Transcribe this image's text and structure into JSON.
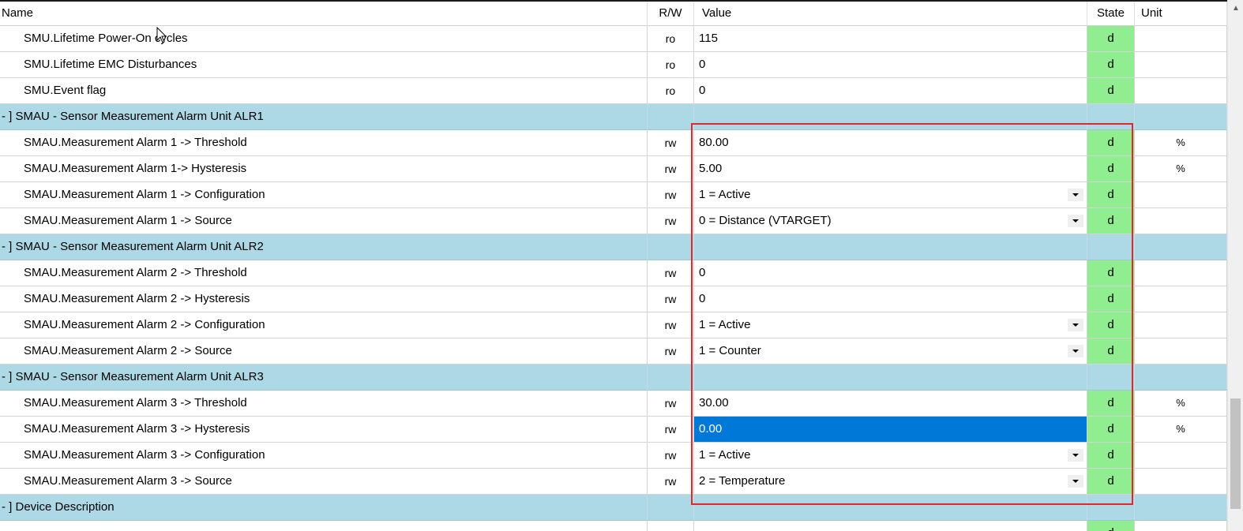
{
  "headers": {
    "name": "Name",
    "rw": "R/W",
    "value": "Value",
    "state": "State",
    "unit": "Unit"
  },
  "rows": [
    {
      "type": "item",
      "name": "SMU.Lifetime Power-On cycles",
      "rw": "ro",
      "value": "115",
      "state": "d",
      "unit": ""
    },
    {
      "type": "item",
      "name": "SMU.Lifetime EMC Disturbances",
      "rw": "ro",
      "value": "0",
      "state": "d",
      "unit": ""
    },
    {
      "type": "item",
      "name": "SMU.Event flag",
      "rw": "ro",
      "value": "0",
      "state": "d",
      "unit": ""
    },
    {
      "type": "group",
      "name": "- ]  SMAU - Sensor Measurement Alarm Unit ALR1"
    },
    {
      "type": "item",
      "name": "SMAU.Measurement Alarm 1 -> Threshold",
      "rw": "rw",
      "value": "80.00",
      "state": "d",
      "unit": "%"
    },
    {
      "type": "item",
      "name": "SMAU.Measurement Alarm 1->  Hysteresis",
      "rw": "rw",
      "value": "5.00",
      "state": "d",
      "unit": "%"
    },
    {
      "type": "item",
      "name": "SMAU.Measurement Alarm 1 -> Configuration",
      "rw": "rw",
      "value": "1 = Active",
      "dropdown": true,
      "state": "d",
      "unit": ""
    },
    {
      "type": "item",
      "name": "SMAU.Measurement Alarm 1 -> Source",
      "rw": "rw",
      "value": "0 = Distance (VTARGET)",
      "dropdown": true,
      "state": "d",
      "unit": ""
    },
    {
      "type": "group",
      "name": "- ]  SMAU - Sensor Measurement Alarm Unit ALR2"
    },
    {
      "type": "item",
      "name": "SMAU.Measurement Alarm 2 -> Threshold",
      "rw": "rw",
      "value": "0",
      "state": "d",
      "unit": ""
    },
    {
      "type": "item",
      "name": "SMAU.Measurement Alarm 2 -> Hysteresis",
      "rw": "rw",
      "value": "0",
      "state": "d",
      "unit": ""
    },
    {
      "type": "item",
      "name": "SMAU.Measurement Alarm 2 -> Configuration",
      "rw": "rw",
      "value": "1 = Active",
      "dropdown": true,
      "state": "d",
      "unit": ""
    },
    {
      "type": "item",
      "name": "SMAU.Measurement Alarm 2 -> Source",
      "rw": "rw",
      "value": "1 = Counter",
      "dropdown": true,
      "state": "d",
      "unit": ""
    },
    {
      "type": "group",
      "name": "- ]  SMAU - Sensor Measurement Alarm Unit ALR3"
    },
    {
      "type": "item",
      "name": "SMAU.Measurement Alarm 3 -> Threshold",
      "rw": "rw",
      "value": "30.00",
      "state": "d",
      "unit": "%"
    },
    {
      "type": "item",
      "name": "SMAU.Measurement Alarm 3 -> Hysteresis",
      "rw": "rw",
      "value": "0.00",
      "selected": true,
      "state": "d",
      "unit": "%"
    },
    {
      "type": "item",
      "name": "SMAU.Measurement Alarm 3 -> Configuration",
      "rw": "rw",
      "value": "1 = Active",
      "dropdown": true,
      "state": "d",
      "unit": ""
    },
    {
      "type": "item",
      "name": "SMAU.Measurement Alarm 3 -> Source",
      "rw": "rw",
      "value": "2 = Temperature",
      "dropdown": true,
      "state": "d",
      "unit": ""
    },
    {
      "type": "group",
      "name": "- ]  Device Description"
    },
    {
      "type": "item",
      "name": "",
      "rw": "",
      "value": "",
      "state": "d",
      "unit": ""
    }
  ],
  "colors": {
    "group_bg": "#add8e6",
    "state_ok": "#90ee90",
    "selection": "#0078d7",
    "highlight_border": "#e0282d"
  },
  "icons": {
    "dropdown": "chevron-down-icon",
    "scroll_up": "scroll-up-arrow-icon",
    "cursor": "mouse-pointer-icon"
  }
}
